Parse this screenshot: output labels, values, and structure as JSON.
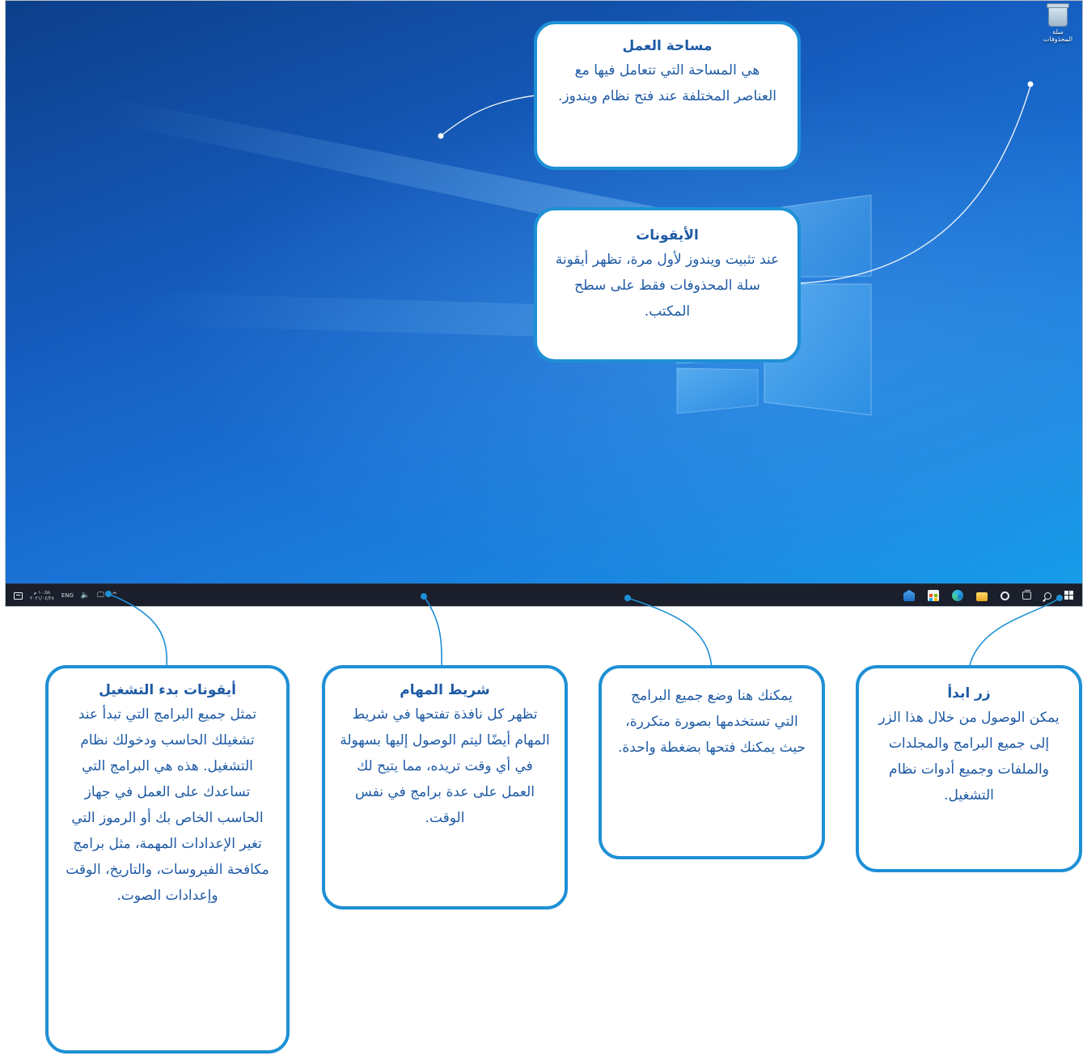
{
  "desktop": {
    "recycle_bin_label": "سلة المحذوفات",
    "taskbar": {
      "language": "ENG",
      "clock_time": "١٠:٥٨ م",
      "clock_date": "٢٠٢١/٠٤/٢٨",
      "overflow_glyph": "^"
    }
  },
  "callouts": {
    "workspace": {
      "title": "مساحة العمل",
      "text": "هي المساحة التي تتعامل فيها مع العناصر المختلفة عند فتح نظام ويندوز."
    },
    "icons": {
      "title": "الأيقونات",
      "text": "عند تثبيت ويندوز لأول مرة، تظهر أيقونة سلة المحذوفات فقط على سطح المكتب."
    },
    "startup_icons": {
      "title": "أيقونات بدء التشغيل",
      "text": "تمثل جميع البرامج التي تبدأ عند تشغيلك الحاسب ودخولك نظام التشغيل. هذه هي البرامج التي تساعدك على العمل في جهاز الحاسب الخاص بك أو الرموز التي تغير الإعدادات المهمة، مثل برامج مكافحة الفيروسات، والتاريخ، الوقت وإعدادات الصوت."
    },
    "taskbar": {
      "title": "شريط المهام",
      "text": "تظهر كل نافذة تفتحها في شريط المهام أيضًا ليتم الوصول إليها بسهولة في أي وقت تريده، مما يتيح لك العمل على عدة برامج في نفس الوقت."
    },
    "pinned": {
      "title": "",
      "text": "يمكنك هنا وضع جميع البرامج التي تستخدمها بصورة متكررة، حيث يمكنك فتحها بضغطة واحدة."
    },
    "start_button": {
      "title": "زر ابدأ",
      "text": "يمكن الوصول من خلال هذا الزر إلى جميع البرامج والمجلدات والملفات وجميع أدوات نظام التشغيل."
    }
  },
  "colors": {
    "callout_border": "#1e90d6",
    "callout_text": "#1e5aa5",
    "taskbar": "#1a1f2b",
    "wallpaper": "#1a73d6"
  }
}
